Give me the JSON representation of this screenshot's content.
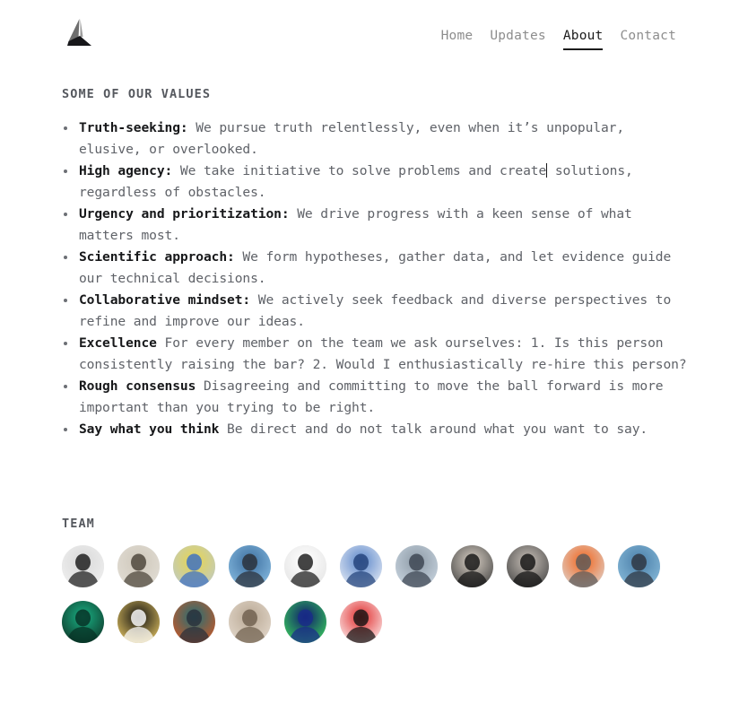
{
  "header": {
    "logo": {
      "icon": "mountain-logo-icon",
      "alt": "Mountain logo"
    },
    "nav": [
      {
        "label": "Home",
        "active": false
      },
      {
        "label": "Updates",
        "active": false
      },
      {
        "label": "About",
        "active": true
      },
      {
        "label": "Contact",
        "active": false
      }
    ]
  },
  "values": {
    "title": "SOME OF OUR VALUES",
    "items": [
      {
        "term": "Truth-seeking:",
        "text": " We pursue truth relentlessly, even when it’s unpopular, elusive, or overlooked.",
        "caret_after": false
      },
      {
        "term": "High agency:",
        "text": " We take initiative to solve problems and create",
        "text_after_caret": " solutions, regardless of obstacles.",
        "caret_after": true
      },
      {
        "term": "Urgency and prioritization:",
        "text": " We drive progress with a keen sense of what matters most.",
        "caret_after": false
      },
      {
        "term": "Scientific approach:",
        "text": " We form hypotheses, gather data, and let evidence guide our technical decisions.",
        "caret_after": false
      },
      {
        "term": "Collaborative mindset:",
        "text": " We actively seek feedback and diverse perspectives to refine and improve our ideas.",
        "caret_after": false
      },
      {
        "term": "Excellence",
        "text": " For every member on the team we ask ourselves: 1. Is this person consistently raising the bar? 2. Would I enthusiastically re-hire this person?",
        "caret_after": false
      },
      {
        "term": "Rough consensus",
        "text": " Disagreeing and committing to move the ball forward is more important than you trying to be right.",
        "caret_after": false
      },
      {
        "term": "Say what you think",
        "text": " Be direct and do not talk around what you want to say.",
        "caret_after": false
      }
    ]
  },
  "team": {
    "title": "TEAM",
    "members": [
      {
        "name": "avatar-woman-bw-portrait",
        "colors": [
          "#f2f2f2",
          "#d9d9d9",
          "#1a1a1a"
        ]
      },
      {
        "name": "avatar-young-man-portrait",
        "colors": [
          "#e4e0d8",
          "#cfc8bb",
          "#4a4338"
        ]
      },
      {
        "name": "avatar-colorful-abstract",
        "colors": [
          "#b9c9d6",
          "#e8d54a",
          "#3b6fc4"
        ]
      },
      {
        "name": "avatar-man-golden-gate-bridge",
        "colors": [
          "#8fc4e8",
          "#3d6fa0",
          "#2b2f38"
        ]
      },
      {
        "name": "avatar-panda-cartoon",
        "colors": [
          "#e2e2e2",
          "#ffffff",
          "#1b1b1b"
        ]
      },
      {
        "name": "avatar-blue-anime-character",
        "colors": [
          "#f2f5fa",
          "#5b86c9",
          "#23427a"
        ]
      },
      {
        "name": "avatar-man-outdoors-photo",
        "colors": [
          "#cfdbe6",
          "#8d9aa6",
          "#3c4450"
        ]
      },
      {
        "name": "avatar-man-glasses-dark-bg",
        "colors": [
          "#3a3a3a",
          "#d8cfc4",
          "#141414"
        ]
      },
      {
        "name": "avatar-man-bw-beard",
        "colors": [
          "#3c3c3c",
          "#c8c0b8",
          "#121212"
        ]
      },
      {
        "name": "avatar-orange-crab-cartoon",
        "colors": [
          "#dcdcdc",
          "#f2651c",
          "#5a5a5a"
        ]
      },
      {
        "name": "avatar-man-fence-background",
        "colors": [
          "#8fc2e0",
          "#4a7ea8",
          "#2e3540"
        ]
      },
      {
        "name": "avatar-green-figure-dark",
        "colors": [
          "#0d2a1f",
          "#19b184",
          "#063024"
        ]
      },
      {
        "name": "avatar-white-mask-yellow-bg",
        "colors": [
          "#f6d46a",
          "#111111",
          "#ffffff"
        ]
      },
      {
        "name": "avatar-game-character-orange",
        "colors": [
          "#e0541c",
          "#1f6f77",
          "#2a2f3a"
        ]
      },
      {
        "name": "avatar-person-light-room",
        "colors": [
          "#e8ded2",
          "#b9a894",
          "#6f5f4e"
        ]
      },
      {
        "name": "avatar-green-neon-profile",
        "colors": [
          "#3ee05a",
          "#0d1c6b",
          "#1a2c8a"
        ]
      },
      {
        "name": "avatar-white-cartoon-creature",
        "colors": [
          "#ffffff",
          "#e02b2b",
          "#141414"
        ]
      }
    ]
  },
  "colors": {
    "page_background": "#ffffff",
    "body_text": "#5f6268",
    "strong_text": "#17181a",
    "muted_nav": "#8d8d8d",
    "active_nav": "#1c1c1c",
    "heading": "#55585e",
    "bullet": "#6c6f75"
  }
}
